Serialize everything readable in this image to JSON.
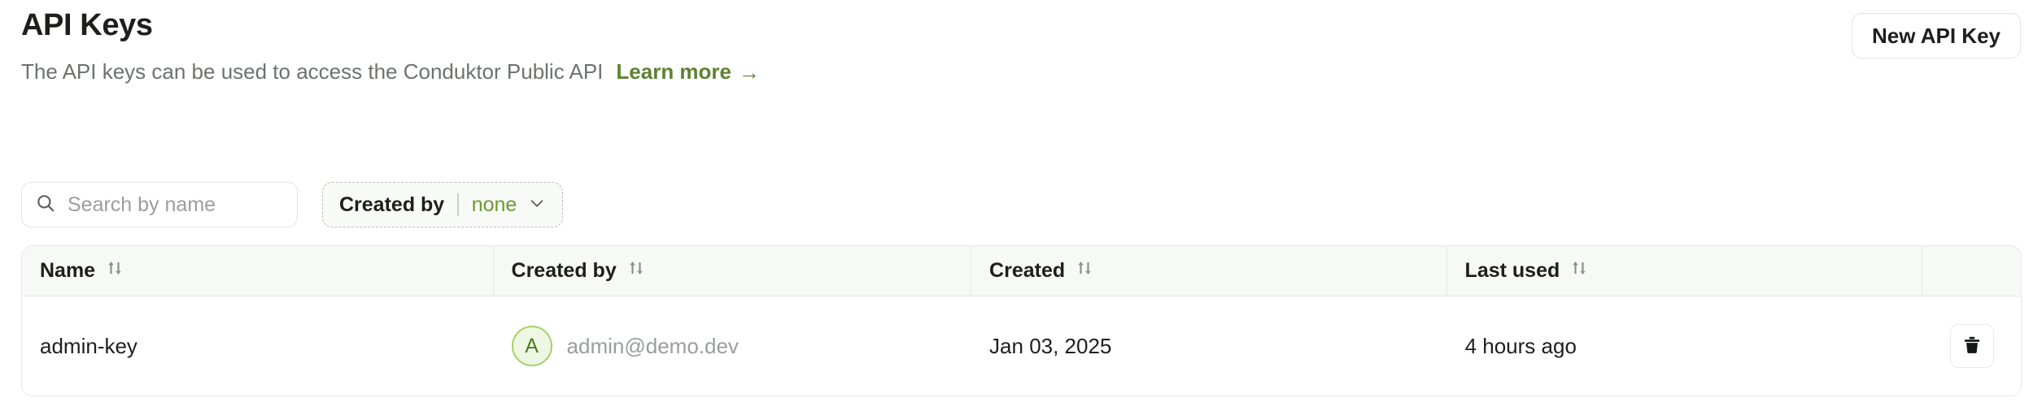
{
  "header": {
    "title": "API Keys",
    "subtitle": "The API keys can be used to access the Conduktor Public API",
    "learn_more_label": "Learn more",
    "learn_more_arrow": "→",
    "new_key_button": "New API Key"
  },
  "filters": {
    "search_placeholder": "Search by name",
    "search_value": "",
    "search_icon": "search-icon",
    "created_by": {
      "label": "Created by",
      "value": "none",
      "chevron_icon": "chevron-down-icon"
    }
  },
  "table": {
    "columns": [
      {
        "label": "Name",
        "sortable": true,
        "sort_icon": "sort-icon"
      },
      {
        "label": "Created by",
        "sortable": true,
        "sort_icon": "sort-icon"
      },
      {
        "label": "Created",
        "sortable": true,
        "sort_icon": "sort-icon"
      },
      {
        "label": "Last used",
        "sortable": true,
        "sort_icon": "sort-icon"
      },
      {
        "label": "",
        "sortable": false,
        "sort_icon": ""
      }
    ],
    "rows": [
      {
        "name": "admin-key",
        "creator_initial": "A",
        "creator_email": "admin@demo.dev",
        "created": "Jan 03, 2025",
        "last_used": "4 hours ago",
        "delete_icon": "trash-icon"
      }
    ]
  },
  "colors": {
    "accent_green": "#5d8230",
    "value_green": "#6b9b2f",
    "avatar_bg": "#eef7e3",
    "avatar_border": "#a8cf6a",
    "avatar_text": "#4e7a23",
    "text_primary": "#1d1f1d",
    "text_muted": "#6e726e",
    "border": "#e6e8e6",
    "header_bg": "#f7f9f7"
  }
}
